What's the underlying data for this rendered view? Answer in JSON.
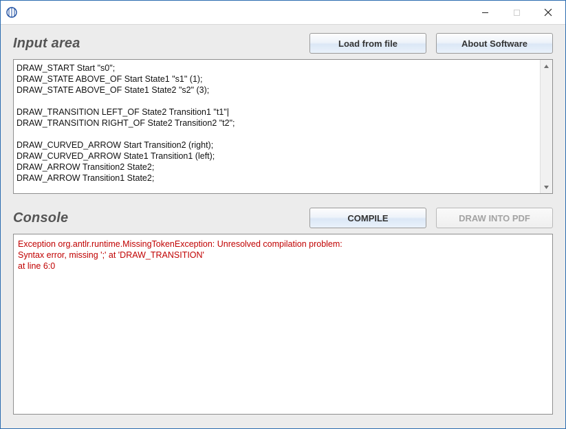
{
  "window": {
    "title": ""
  },
  "input_section": {
    "title": "Input area",
    "buttons": {
      "load": "Load from file",
      "about": "About Software"
    },
    "code_lines": [
      "DRAW_START Start \"s0\";",
      "DRAW_STATE ABOVE_OF Start State1 \"s1\" (1);",
      "DRAW_STATE ABOVE_OF State1 State2 \"s2\" (3);",
      "",
      "DRAW_TRANSITION LEFT_OF State2 Transition1 \"t1\"",
      "DRAW_TRANSITION RIGHT_OF State2 Transition2 \"t2\";",
      "",
      "DRAW_CURVED_ARROW Start Transition2 (right);",
      "DRAW_CURVED_ARROW State1 Transition1 (left);",
      "DRAW_ARROW Transition2 State2;",
      "DRAW_ARROW Transition1 State2;"
    ],
    "cursor_after_line_index": 4
  },
  "console_section": {
    "title": "Console",
    "buttons": {
      "compile": "COMPILE",
      "draw_pdf": "DRAW INTO PDF"
    },
    "draw_pdf_enabled": false,
    "output_lines": [
      "Exception org.antlr.runtime.MissingTokenException: Unresolved compilation problem:",
      "Syntax error, missing ';' at 'DRAW_TRANSITION'",
      "at line 6:0"
    ]
  }
}
